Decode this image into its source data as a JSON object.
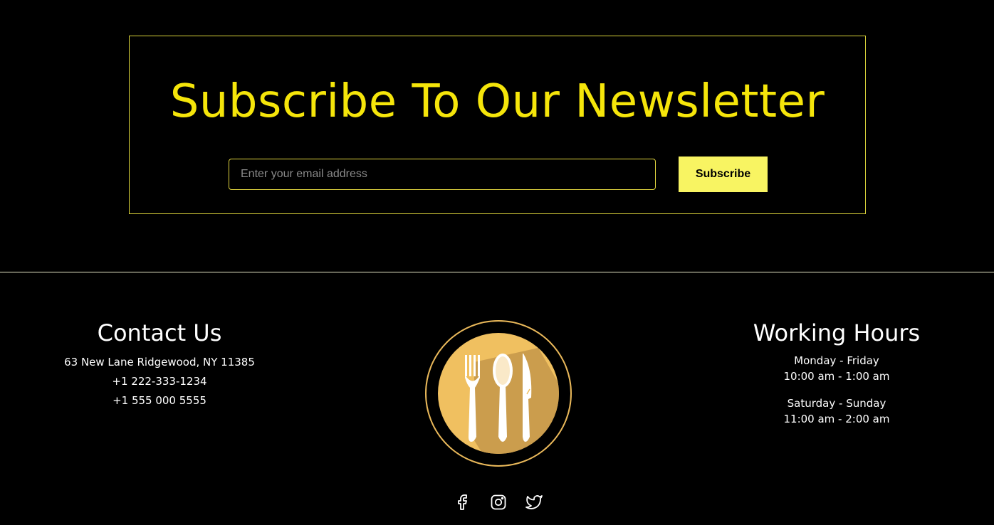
{
  "newsletter": {
    "title": "Subscribe To Our Newsletter",
    "email_placeholder": "Enter your email address",
    "email_value": "",
    "subscribe_label": "Subscribe"
  },
  "contact": {
    "title": "Contact Us",
    "address": "63 New Lane Ridgewood, NY 11385",
    "phone_1": "+1 222-333-1234",
    "phone_2": "+1 555 000 5555"
  },
  "hours": {
    "title": "Working Hours",
    "weekday_label": "Monday - Friday",
    "weekday_time": "10:00 am - 1:00 am",
    "weekend_label": "Saturday - Sunday",
    "weekend_time": "11:00 am - 2:00 am"
  },
  "logo": {
    "icon": "fork-spoon-knife-icon"
  },
  "socials": [
    {
      "icon": "facebook-icon"
    },
    {
      "icon": "instagram-icon"
    },
    {
      "icon": "twitter-icon"
    }
  ],
  "colors": {
    "background": "#000000",
    "accent_yellow": "#f5e50a",
    "button_yellow": "#f8f462",
    "logo_gold": "#f0c060",
    "logo_shadow": "#c4964a"
  }
}
